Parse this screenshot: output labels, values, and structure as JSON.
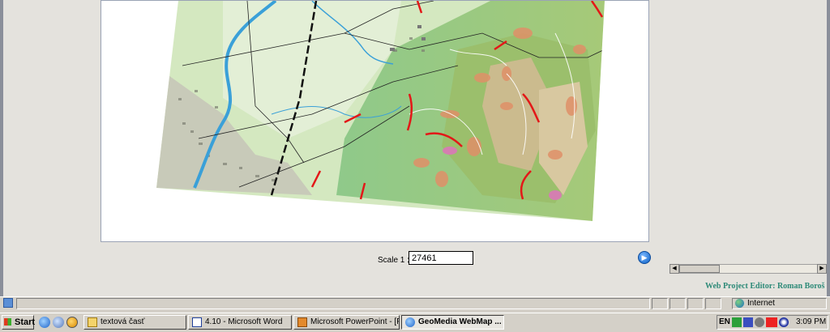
{
  "map": {
    "scale_prefix": "Scale  1 :",
    "scale_value": "27461"
  },
  "footer": {
    "editor_credit": "Web Project Editor: Roman Boroš"
  },
  "statusbar": {
    "zone": "Internet"
  },
  "taskbar": {
    "start_label": "Start",
    "tasks": [
      {
        "label": "textová časť",
        "icon": "folder-icon"
      },
      {
        "label": "4.10 - Microsoft Word",
        "icon": "word-icon"
      },
      {
        "label": "Microsoft PowerPoint - [Pr...",
        "icon": "powerpoint-icon"
      },
      {
        "label": "GeoMedia WebMap ...",
        "icon": "internet-explorer-icon",
        "active": true
      }
    ],
    "language": "EN",
    "clock": "3:09 PM"
  },
  "colors": {
    "accent": "#2d8a78",
    "desktop": "#d4d0c8"
  }
}
